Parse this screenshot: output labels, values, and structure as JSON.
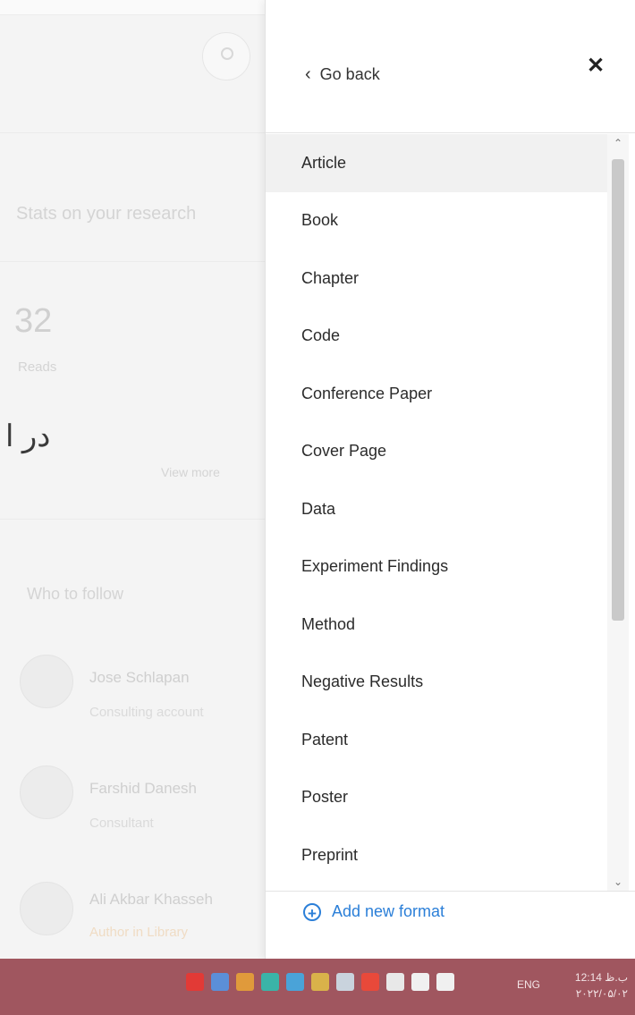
{
  "background": {
    "stats_heading": "Stats on your research",
    "reads_count": "32",
    "reads_label": "Reads",
    "farsi_text": "در ا",
    "view_more": "View more",
    "follow_heading": "Who to follow",
    "people": [
      {
        "name": "Jose Schlapan",
        "role": "Consulting account"
      },
      {
        "name": "Farshid Danesh",
        "role": "Consultant"
      },
      {
        "name": "Ali Akbar Khasseh",
        "role": "Author in Library"
      }
    ]
  },
  "panel": {
    "back_label": "Go back",
    "close_symbol": "✕",
    "formats": [
      "Article",
      "Book",
      "Chapter",
      "Code",
      "Conference Paper",
      "Cover Page",
      "Data",
      "Experiment Findings",
      "Method",
      "Negative Results",
      "Patent",
      "Poster",
      "Preprint"
    ],
    "selected_format": "Article",
    "add_label": "Add new format"
  },
  "taskbar": {
    "language": "ENG",
    "time": "12:14 ب.ظ",
    "date": "۲۰۲۲/۰۵/۰۲",
    "tray_icons": [
      "red-app-icon",
      "blue-app-icon",
      "orange-app-icon",
      "teal-app-icon",
      "globe-icon",
      "folder-icon",
      "network-icon",
      "s-app-icon",
      "battery-icon",
      "volume-icon",
      "signal-icon"
    ],
    "tray_colors": [
      "#e23a36",
      "#5b8fd8",
      "#e09a3b",
      "#3ab4a8",
      "#4aa3d8",
      "#d9b24a",
      "#c9d3dd",
      "#e8493a",
      "#e8e8e8",
      "#f0f0f0",
      "#f0f0f0"
    ]
  }
}
